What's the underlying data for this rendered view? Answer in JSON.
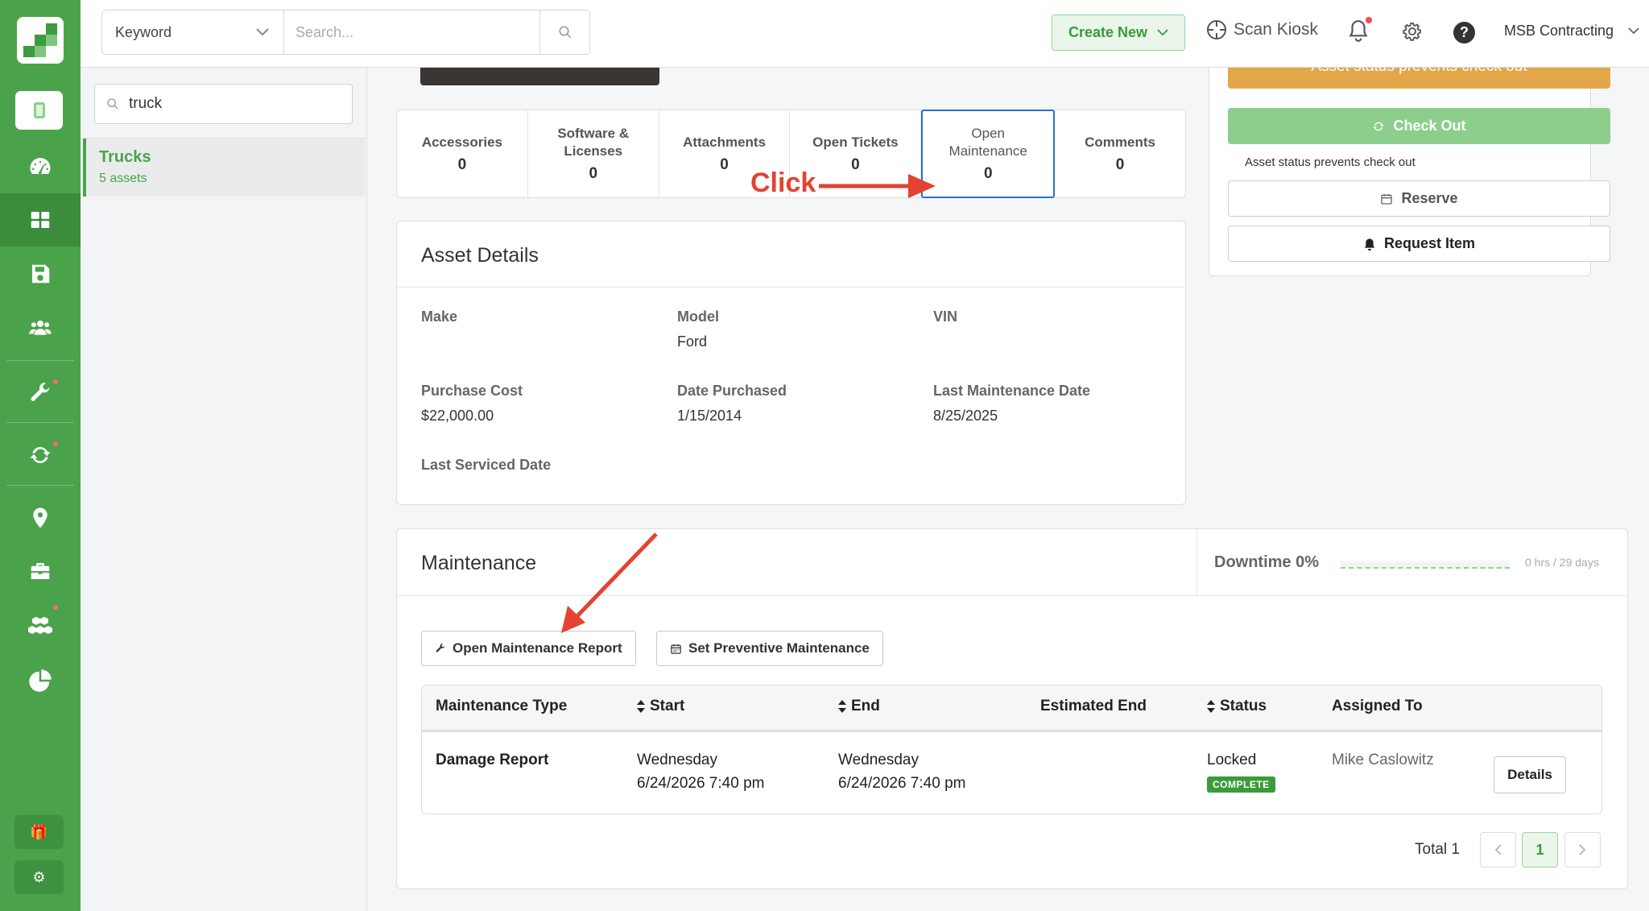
{
  "topbar": {
    "search_mode": "Keyword",
    "search_placeholder": "Search...",
    "create_new": "Create New",
    "scan_kiosk": "Scan Kiosk",
    "org_name": "MSB Contracting"
  },
  "sidebar": {
    "search_value": "truck",
    "group": {
      "name": "Trucks",
      "count": "5 assets"
    }
  },
  "tabs": [
    {
      "label": "Accessories",
      "value": "0"
    },
    {
      "label": "Software & Licenses",
      "value": "0"
    },
    {
      "label": "Attachments",
      "value": "0"
    },
    {
      "label": "Open Tickets",
      "value": "0"
    },
    {
      "label": "Open Maintenance",
      "value": "0"
    },
    {
      "label": "Comments",
      "value": "0"
    }
  ],
  "annotation": {
    "click_label": "Click"
  },
  "asset_details": {
    "title": "Asset Details",
    "make_label": "Make",
    "make_value": "",
    "model_label": "Model",
    "model_value": "Ford",
    "vin_label": "VIN",
    "vin_value": "",
    "purchase_cost_label": "Purchase Cost",
    "purchase_cost_value": "$22,000.00",
    "date_purchased_label": "Date Purchased",
    "date_purchased_value": "1/15/2014",
    "last_maint_label": "Last Maintenance Date",
    "last_maint_value": "8/25/2025",
    "last_serviced_label": "Last Serviced Date",
    "last_serviced_value": ""
  },
  "actions": {
    "warning": "Asset status prevents check out",
    "check_out": "Check Out",
    "status_note": "Asset status prevents check out",
    "reserve": "Reserve",
    "request_item": "Request Item"
  },
  "maintenance": {
    "title": "Maintenance",
    "downtime": "Downtime 0%",
    "downtime_note": "0 hrs / 29 days",
    "open_report": "Open Maintenance Report",
    "set_preventive": "Set Preventive Maintenance",
    "columns": {
      "type": "Maintenance Type",
      "start": "Start",
      "end": "End",
      "est_end": "Estimated End",
      "status": "Status",
      "assigned": "Assigned To"
    },
    "rows": [
      {
        "type": "Damage Report",
        "start_day": "Wednesday",
        "start_time": "6/24/2026 7:40 pm",
        "end_day": "Wednesday",
        "end_time": "6/24/2026 7:40 pm",
        "status": "Locked",
        "badge": "COMPLETE",
        "assigned": "Mike Caslowitz",
        "details": "Details"
      }
    ],
    "total": "Total 1",
    "page": "1"
  },
  "colors": {
    "brand_green": "#4aa34a",
    "warning": "#e3a74a",
    "annotation_red": "#e44233",
    "selected_blue": "#2a6fd6"
  }
}
